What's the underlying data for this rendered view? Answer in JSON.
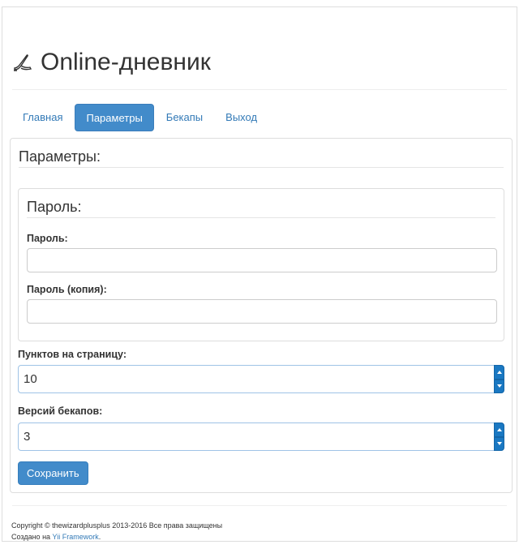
{
  "header": {
    "title": "Online-дневник",
    "icon": "quill-pen-icon"
  },
  "nav": {
    "tabs": [
      {
        "label": "Главная",
        "active": false
      },
      {
        "label": "Параметры",
        "active": true
      },
      {
        "label": "Бекапы",
        "active": false
      },
      {
        "label": "Выход",
        "active": false
      }
    ]
  },
  "form": {
    "legend": "Параметры:",
    "password_section": {
      "legend": "Пароль:",
      "password_label": "Пароль:",
      "password_value": "",
      "password_copy_label": "Пароль (копия):",
      "password_copy_value": ""
    },
    "points_per_page_label": "Пунктов на страницу:",
    "points_per_page_value": "10",
    "backup_versions_label": "Версий бекапов:",
    "backup_versions_value": "3",
    "save_label": "Сохранить"
  },
  "footer": {
    "copyright": "Copyright © thewizardplusplus 2013-2016 Все права защищены",
    "created_prefix": "Создано на ",
    "framework_link": "Yii Framework",
    "created_suffix": "."
  },
  "colors": {
    "accent": "#428bca",
    "link": "#337ab7",
    "spinner": "#1a78c2"
  }
}
